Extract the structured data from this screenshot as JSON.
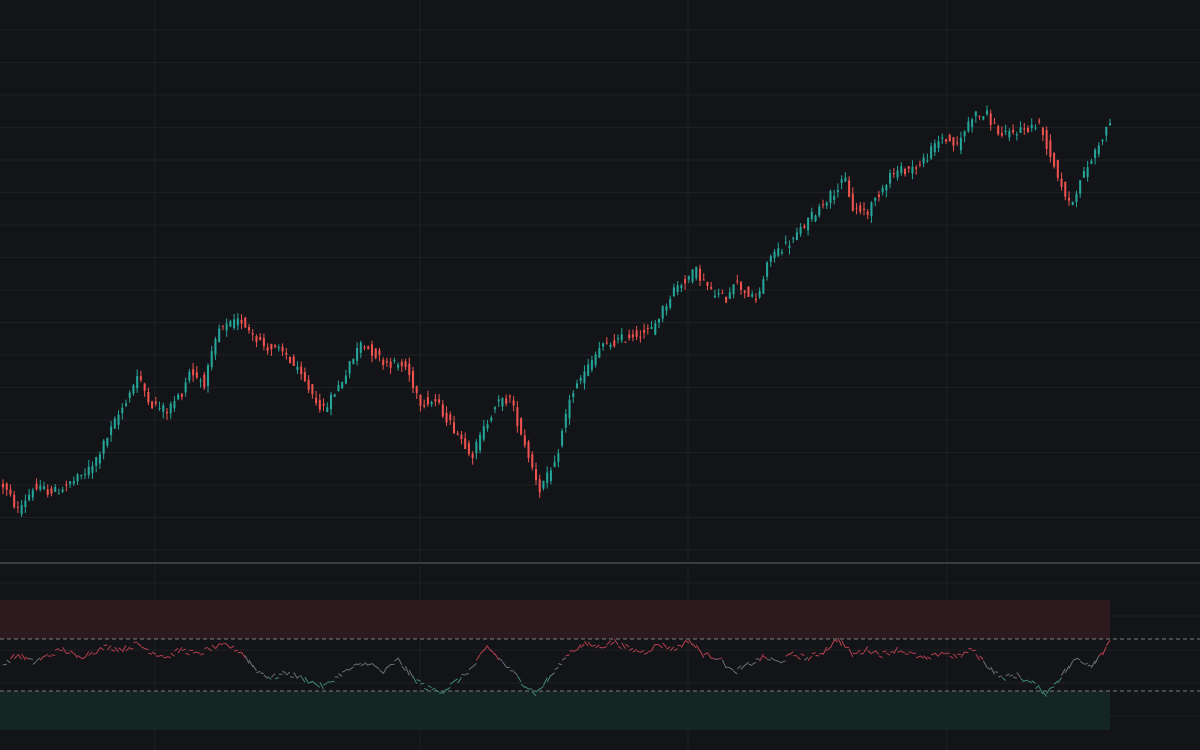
{
  "theme": {
    "background": "#131417",
    "grid": "#1e2024",
    "separator": "#3a3c42",
    "up_color": "#26a69a",
    "down_color": "#ef5350",
    "overbought_zone": "#2c1a1e",
    "oversold_zone": "#142522",
    "threshold_line": "#7a7c82"
  },
  "chart_data": [
    {
      "type": "candlestick",
      "panel": "price",
      "title": "",
      "xlabel": "",
      "ylabel": "",
      "grid": true,
      "x_range": [
        0,
        297
      ],
      "ylim": [
        0,
        18
      ],
      "anchors": [
        [
          0,
          2.4
        ],
        [
          4,
          1.6
        ],
        [
          8,
          2.3
        ],
        [
          14,
          2.2
        ],
        [
          20,
          2.6
        ],
        [
          24,
          3.0
        ],
        [
          32,
          4.9
        ],
        [
          36,
          5.9
        ],
        [
          40,
          5.0
        ],
        [
          44,
          4.8
        ],
        [
          48,
          5.4
        ],
        [
          50,
          6.1
        ],
        [
          54,
          5.7
        ],
        [
          58,
          7.4
        ],
        [
          64,
          7.7
        ],
        [
          70,
          6.9
        ],
        [
          76,
          6.6
        ],
        [
          86,
          4.8
        ],
        [
          92,
          6.0
        ],
        [
          96,
          7.0
        ],
        [
          102,
          6.4
        ],
        [
          108,
          6.2
        ],
        [
          112,
          5.1
        ],
        [
          116,
          5.1
        ],
        [
          120,
          4.4
        ],
        [
          126,
          3.4
        ],
        [
          132,
          5.0
        ],
        [
          136,
          5.2
        ],
        [
          142,
          3.0
        ],
        [
          144,
          2.3
        ],
        [
          148,
          3.0
        ],
        [
          152,
          5.2
        ],
        [
          156,
          6.0
        ],
        [
          160,
          6.8
        ],
        [
          168,
          7.2
        ],
        [
          174,
          7.4
        ],
        [
          180,
          8.7
        ],
        [
          186,
          9.3
        ],
        [
          190,
          8.6
        ],
        [
          194,
          8.4
        ],
        [
          196,
          9.0
        ],
        [
          202,
          8.3
        ],
        [
          206,
          9.8
        ],
        [
          212,
          10.3
        ],
        [
          220,
          11.5
        ],
        [
          226,
          12.2
        ],
        [
          228,
          11.3
        ],
        [
          232,
          11.2
        ],
        [
          238,
          12.4
        ],
        [
          246,
          12.7
        ],
        [
          252,
          13.6
        ],
        [
          256,
          13.3
        ],
        [
          260,
          14.3
        ],
        [
          264,
          14.3
        ],
        [
          268,
          13.6
        ],
        [
          272,
          13.8
        ],
        [
          278,
          14.0
        ],
        [
          282,
          12.7
        ],
        [
          286,
          11.4
        ],
        [
          290,
          12.4
        ],
        [
          294,
          13.4
        ],
        [
          297,
          14.1
        ]
      ]
    },
    {
      "type": "line",
      "panel": "oscillator",
      "title": "",
      "xlabel": "",
      "ylabel": "",
      "grid": true,
      "x_range": [
        0,
        297
      ],
      "ylim": [
        0,
        100
      ],
      "bands": {
        "upper": 70,
        "lower": 30
      },
      "zones": [
        {
          "from": 70,
          "to": 100
        },
        {
          "from": 0,
          "to": 30
        }
      ],
      "anchors": [
        [
          0,
          50
        ],
        [
          4,
          58
        ],
        [
          8,
          52
        ],
        [
          12,
          57
        ],
        [
          16,
          62
        ],
        [
          20,
          56
        ],
        [
          24,
          60
        ],
        [
          28,
          64
        ],
        [
          32,
          62
        ],
        [
          36,
          66
        ],
        [
          40,
          60
        ],
        [
          44,
          56
        ],
        [
          48,
          62
        ],
        [
          52,
          58
        ],
        [
          56,
          63
        ],
        [
          60,
          65
        ],
        [
          64,
          60
        ],
        [
          68,
          46
        ],
        [
          72,
          40
        ],
        [
          76,
          44
        ],
        [
          82,
          38
        ],
        [
          86,
          33
        ],
        [
          90,
          42
        ],
        [
          94,
          48
        ],
        [
          98,
          52
        ],
        [
          102,
          44
        ],
        [
          106,
          54
        ],
        [
          110,
          40
        ],
        [
          114,
          32
        ],
        [
          118,
          30
        ],
        [
          122,
          38
        ],
        [
          126,
          48
        ],
        [
          130,
          64
        ],
        [
          134,
          52
        ],
        [
          140,
          35
        ],
        [
          143,
          28
        ],
        [
          148,
          45
        ],
        [
          152,
          60
        ],
        [
          156,
          66
        ],
        [
          160,
          64
        ],
        [
          164,
          68
        ],
        [
          168,
          62
        ],
        [
          172,
          60
        ],
        [
          176,
          66
        ],
        [
          180,
          62
        ],
        [
          184,
          69
        ],
        [
          188,
          58
        ],
        [
          192,
          56
        ],
        [
          196,
          44
        ],
        [
          200,
          50
        ],
        [
          204,
          56
        ],
        [
          208,
          52
        ],
        [
          212,
          58
        ],
        [
          216,
          55
        ],
        [
          220,
          60
        ],
        [
          224,
          70
        ],
        [
          228,
          58
        ],
        [
          232,
          62
        ],
        [
          236,
          58
        ],
        [
          240,
          62
        ],
        [
          244,
          58
        ],
        [
          248,
          54
        ],
        [
          252,
          60
        ],
        [
          256,
          56
        ],
        [
          260,
          62
        ],
        [
          264,
          50
        ],
        [
          268,
          40
        ],
        [
          272,
          42
        ],
        [
          276,
          36
        ],
        [
          280,
          28
        ],
        [
          284,
          42
        ],
        [
          288,
          55
        ],
        [
          292,
          50
        ],
        [
          295,
          60
        ],
        [
          297,
          70
        ]
      ]
    }
  ]
}
